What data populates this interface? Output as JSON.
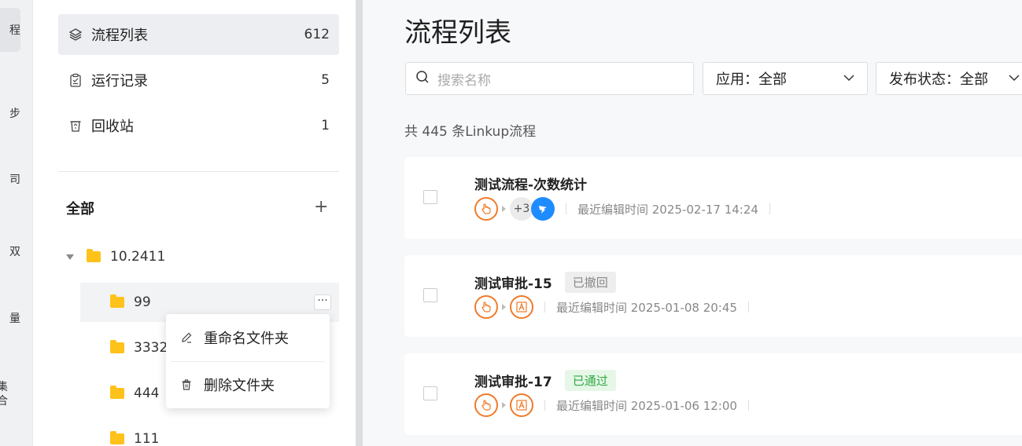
{
  "rail": {
    "items": [
      {
        "label": "程"
      },
      {
        "label": "步"
      },
      {
        "label": "司"
      },
      {
        "label": "双"
      },
      {
        "label": "量"
      },
      {
        "label": "集合"
      }
    ]
  },
  "sidebar": {
    "nav": [
      {
        "label": "流程列表",
        "count": "612",
        "icon": "layers-icon"
      },
      {
        "label": "运行记录",
        "count": "5",
        "icon": "clipboard-icon"
      },
      {
        "label": "回收站",
        "count": "1",
        "icon": "recycle-bin-icon"
      }
    ],
    "all_header": "全部",
    "add_symbol": "+",
    "tree": [
      {
        "label": "10.2411"
      },
      {
        "label": "99"
      },
      {
        "label": "3332"
      },
      {
        "label": "444"
      },
      {
        "label": "111"
      }
    ],
    "more_symbol": "···"
  },
  "context_menu": {
    "rename": "重命名文件夹",
    "delete": "删除文件夹"
  },
  "main": {
    "title": "流程列表",
    "search_placeholder": "搜索名称",
    "app_filter": "应用：全部",
    "status_filter": "发布状态：全部",
    "total": "共 445 条Linkup流程",
    "cards": [
      {
        "title": "测试流程-次数统计",
        "badge": "",
        "extra_count": "+3",
        "edited": "最近编辑时间 2025-02-17 14:24"
      },
      {
        "title": "测试审批-15",
        "badge": "已撤回",
        "edited": "最近编辑时间 2025-01-08 20:45"
      },
      {
        "title": "测试审批-17",
        "badge": "已通过",
        "edited": "最近编辑时间 2025-01-06 12:00"
      }
    ]
  },
  "colors": {
    "accent_orange": "#f07b2a",
    "folder_yellow": "#ffc21a",
    "dingtalk_blue": "#1e8cff",
    "approved_green": "#2eaa3f"
  }
}
